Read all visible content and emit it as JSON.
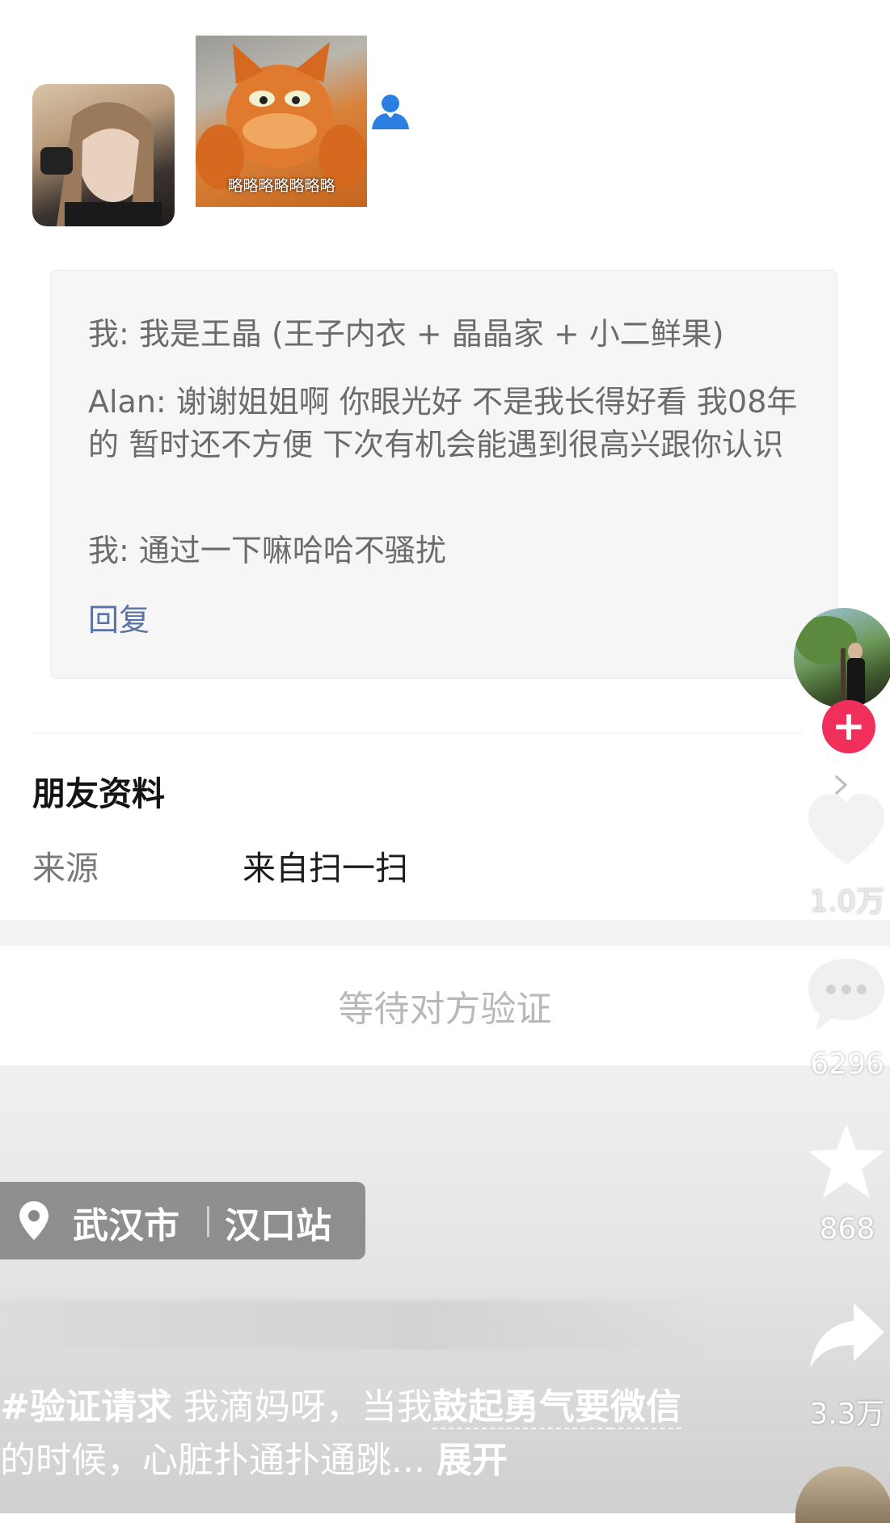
{
  "photos": {
    "caption2": "略略略略略略略"
  },
  "messages": [
    {
      "text": "我: 我是王晶 (王子内衣 + 晶晶家 + 小二鲜果)"
    },
    {
      "text": "Alan: 谢谢姐姐啊 你眼光好 不是我长得好看 我08年的 暂时还不方便 下次有机会能遇到很高兴跟你认识"
    },
    {
      "text": "我: 通过一下嘛哈哈不骚扰"
    }
  ],
  "reply_label": "回复",
  "friend_info": {
    "title": "朋友资料",
    "source_label": "来源",
    "source_value": "来自扫一扫"
  },
  "wait_label": "等待对方验证",
  "rail": {
    "follow_symbol": "+",
    "like_count": "1.0万",
    "comment_count": "6296",
    "favorite_count": "868",
    "share_count": "3.3万"
  },
  "location": {
    "city": "武汉市",
    "station": "汉口站"
  },
  "caption": {
    "hashtag": "#验证请求",
    "part1": " 我滴妈呀，当我",
    "kw1": "鼓起勇气要",
    "kw2": "微信",
    "part2": "的时候，心脏扑通扑通跳... ",
    "more": "展开"
  },
  "colors": {
    "follow": "#f0305a",
    "reply": "#5a72a6",
    "contact_icon": "#2b7fe0"
  }
}
